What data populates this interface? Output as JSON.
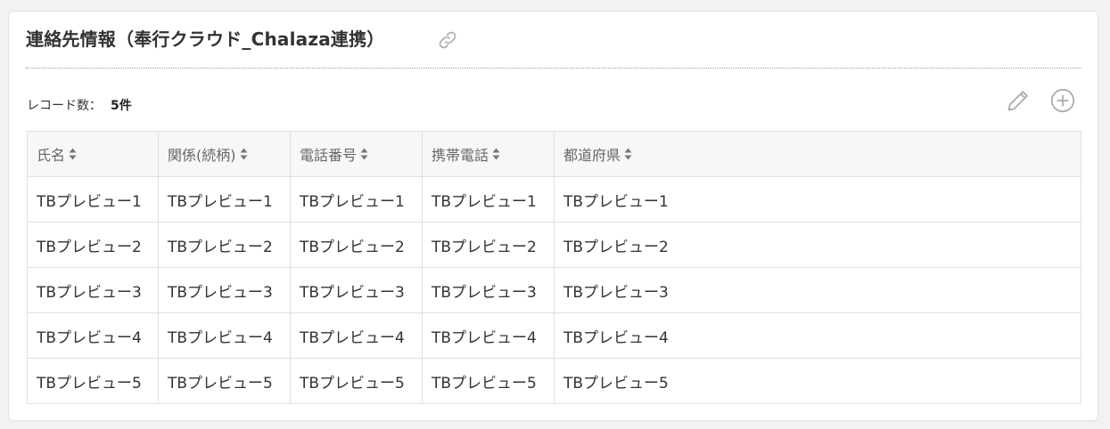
{
  "panel": {
    "title": "連絡先情報（奉行クラウド_Chalaza連携）",
    "link_icon": "link-icon",
    "record_label": "レコード数：",
    "record_count": "5件",
    "edit_icon": "pencil-icon",
    "add_icon": "plus-circle-icon"
  },
  "table": {
    "columns": [
      {
        "label": "氏名",
        "sort_icon": "sort-icon"
      },
      {
        "label": "関係(続柄)",
        "sort_icon": "sort-icon"
      },
      {
        "label": "電話番号",
        "sort_icon": "sort-icon"
      },
      {
        "label": "携帯電話",
        "sort_icon": "sort-icon"
      },
      {
        "label": "都道府県",
        "sort_icon": "sort-icon"
      }
    ],
    "rows": [
      [
        "TBプレビュー1",
        "TBプレビュー1",
        "TBプレビュー1",
        "TBプレビュー1",
        "TBプレビュー1"
      ],
      [
        "TBプレビュー2",
        "TBプレビュー2",
        "TBプレビュー2",
        "TBプレビュー2",
        "TBプレビュー2"
      ],
      [
        "TBプレビュー3",
        "TBプレビュー3",
        "TBプレビュー3",
        "TBプレビュー3",
        "TBプレビュー3"
      ],
      [
        "TBプレビュー4",
        "TBプレビュー4",
        "TBプレビュー4",
        "TBプレビュー4",
        "TBプレビュー4"
      ],
      [
        "TBプレビュー5",
        "TBプレビュー5",
        "TBプレビュー5",
        "TBプレビュー5",
        "TBプレビュー5"
      ]
    ]
  },
  "colors": {
    "icon_gray": "#a9a9a9",
    "header_bg": "#f7f7f8",
    "border": "#e0e0e0"
  }
}
